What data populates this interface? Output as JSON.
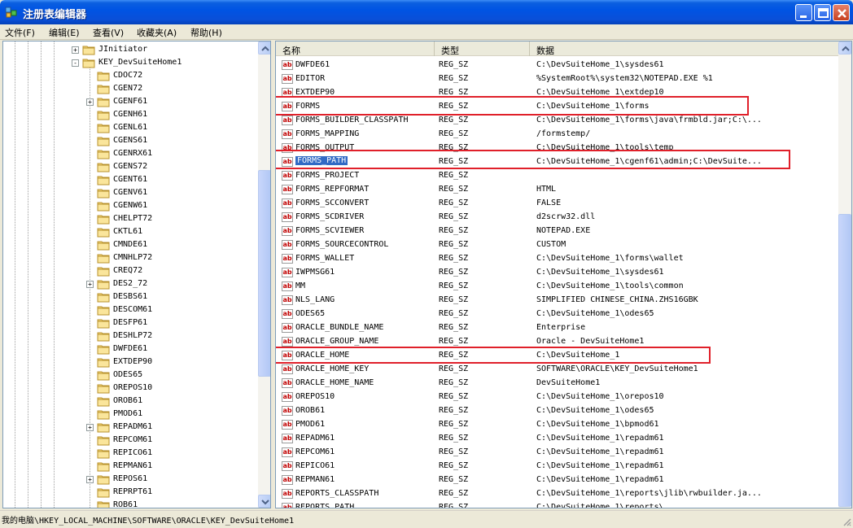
{
  "window": {
    "title": "注册表编辑器"
  },
  "menu": [
    {
      "label": "文件(F)"
    },
    {
      "label": "编辑(E)"
    },
    {
      "label": "查看(V)"
    },
    {
      "label": "收藏夹(A)"
    },
    {
      "label": "帮助(H)"
    }
  ],
  "tree": {
    "nodes": [
      {
        "label": "JInitiator",
        "expander": "+",
        "level": 0
      },
      {
        "label": "KEY_DevSuiteHome1",
        "expander": "-",
        "level": 0,
        "open": true
      },
      {
        "label": "CDOC72",
        "expander": "",
        "level": 1
      },
      {
        "label": "CGEN72",
        "expander": "",
        "level": 1
      },
      {
        "label": "CGENF61",
        "expander": "+",
        "level": 1
      },
      {
        "label": "CGENH61",
        "expander": "",
        "level": 1
      },
      {
        "label": "CGENL61",
        "expander": "",
        "level": 1
      },
      {
        "label": "CGENS61",
        "expander": "",
        "level": 1
      },
      {
        "label": "CGENRX61",
        "expander": "",
        "level": 1
      },
      {
        "label": "CGENS72",
        "expander": "",
        "level": 1
      },
      {
        "label": "CGENT61",
        "expander": "",
        "level": 1
      },
      {
        "label": "CGENV61",
        "expander": "",
        "level": 1
      },
      {
        "label": "CGENW61",
        "expander": "",
        "level": 1
      },
      {
        "label": "CHELPT72",
        "expander": "",
        "level": 1
      },
      {
        "label": "CKTL61",
        "expander": "",
        "level": 1
      },
      {
        "label": "CMNDE61",
        "expander": "",
        "level": 1
      },
      {
        "label": "CMNHLP72",
        "expander": "",
        "level": 1
      },
      {
        "label": "CREQ72",
        "expander": "",
        "level": 1
      },
      {
        "label": "DES2_72",
        "expander": "+",
        "level": 1
      },
      {
        "label": "DESBS61",
        "expander": "",
        "level": 1
      },
      {
        "label": "DESCOM61",
        "expander": "",
        "level": 1
      },
      {
        "label": "DESFP61",
        "expander": "",
        "level": 1
      },
      {
        "label": "DESHLP72",
        "expander": "",
        "level": 1
      },
      {
        "label": "DWFDE61",
        "expander": "",
        "level": 1
      },
      {
        "label": "EXTDEP90",
        "expander": "",
        "level": 1
      },
      {
        "label": "ODES65",
        "expander": "",
        "level": 1
      },
      {
        "label": "OREPOS10",
        "expander": "",
        "level": 1
      },
      {
        "label": "OROB61",
        "expander": "",
        "level": 1
      },
      {
        "label": "PMOD61",
        "expander": "",
        "level": 1
      },
      {
        "label": "REPADM61",
        "expander": "+",
        "level": 1
      },
      {
        "label": "REPCOM61",
        "expander": "",
        "level": 1
      },
      {
        "label": "REPICO61",
        "expander": "",
        "level": 1
      },
      {
        "label": "REPMAN61",
        "expander": "",
        "level": 1
      },
      {
        "label": "REPOS61",
        "expander": "+",
        "level": 1
      },
      {
        "label": "REPRPT61",
        "expander": "",
        "level": 1
      },
      {
        "label": "ROB61",
        "expander": "",
        "level": 1
      }
    ]
  },
  "list": {
    "columns": [
      "名称",
      "类型",
      "数据"
    ],
    "rows": [
      {
        "name": "DWFDE61",
        "type": "REG_SZ",
        "data": "C:\\DevSuiteHome_1\\sysdes61"
      },
      {
        "name": "EDITOR",
        "type": "REG_SZ",
        "data": "%SystemRoot%\\system32\\NOTEPAD.EXE %1"
      },
      {
        "name": "EXTDEP90",
        "type": "REG_SZ",
        "data": "C:\\DevSuiteHome_1\\extdep10"
      },
      {
        "name": "FORMS",
        "type": "REG_SZ",
        "data": "C:\\DevSuiteHome_1\\forms"
      },
      {
        "name": "FORMS_BUILDER_CLASSPATH",
        "type": "REG_SZ",
        "data": "C:\\DevSuiteHome_1\\forms\\java\\frmbld.jar;C:\\..."
      },
      {
        "name": "FORMS_MAPPING",
        "type": "REG_SZ",
        "data": "/formstemp/"
      },
      {
        "name": "FORMS_OUTPUT",
        "type": "REG_SZ",
        "data": "C:\\DevSuiteHome_1\\tools\\temp"
      },
      {
        "name": "FORMS_PATH",
        "type": "REG_SZ",
        "data": "C:\\DevSuiteHome_1\\cgenf61\\admin;C:\\DevSuite...",
        "selected": true
      },
      {
        "name": "FORMS_PROJECT",
        "type": "REG_SZ",
        "data": ""
      },
      {
        "name": "FORMS_REPFORMAT",
        "type": "REG_SZ",
        "data": "HTML"
      },
      {
        "name": "FORMS_SCCONVERT",
        "type": "REG_SZ",
        "data": "FALSE"
      },
      {
        "name": "FORMS_SCDRIVER",
        "type": "REG_SZ",
        "data": "d2scrw32.dll"
      },
      {
        "name": "FORMS_SCVIEWER",
        "type": "REG_SZ",
        "data": "NOTEPAD.EXE"
      },
      {
        "name": "FORMS_SOURCECONTROL",
        "type": "REG_SZ",
        "data": "CUSTOM"
      },
      {
        "name": "FORMS_WALLET",
        "type": "REG_SZ",
        "data": "C:\\DevSuiteHome_1\\forms\\wallet"
      },
      {
        "name": "IWPMSG61",
        "type": "REG_SZ",
        "data": "C:\\DevSuiteHome_1\\sysdes61"
      },
      {
        "name": "MM",
        "type": "REG_SZ",
        "data": "C:\\DevSuiteHome_1\\tools\\common"
      },
      {
        "name": "NLS_LANG",
        "type": "REG_SZ",
        "data": "SIMPLIFIED CHINESE_CHINA.ZHS16GBK"
      },
      {
        "name": "ODES65",
        "type": "REG_SZ",
        "data": "C:\\DevSuiteHome_1\\odes65"
      },
      {
        "name": "ORACLE_BUNDLE_NAME",
        "type": "REG_SZ",
        "data": "Enterprise"
      },
      {
        "name": "ORACLE_GROUP_NAME",
        "type": "REG_SZ",
        "data": "Oracle - DevSuiteHome1"
      },
      {
        "name": "ORACLE_HOME",
        "type": "REG_SZ",
        "data": "C:\\DevSuiteHome_1"
      },
      {
        "name": "ORACLE_HOME_KEY",
        "type": "REG_SZ",
        "data": "SOFTWARE\\ORACLE\\KEY_DevSuiteHome1"
      },
      {
        "name": "ORACLE_HOME_NAME",
        "type": "REG_SZ",
        "data": "DevSuiteHome1"
      },
      {
        "name": "OREPOS10",
        "type": "REG_SZ",
        "data": "C:\\DevSuiteHome_1\\orepos10"
      },
      {
        "name": "OROB61",
        "type": "REG_SZ",
        "data": "C:\\DevSuiteHome_1\\odes65"
      },
      {
        "name": "PMOD61",
        "type": "REG_SZ",
        "data": "C:\\DevSuiteHome_1\\bpmod61"
      },
      {
        "name": "REPADM61",
        "type": "REG_SZ",
        "data": "C:\\DevSuiteHome_1\\repadm61"
      },
      {
        "name": "REPCOM61",
        "type": "REG_SZ",
        "data": "C:\\DevSuiteHome_1\\repadm61"
      },
      {
        "name": "REPICO61",
        "type": "REG_SZ",
        "data": "C:\\DevSuiteHome_1\\repadm61"
      },
      {
        "name": "REPMAN61",
        "type": "REG_SZ",
        "data": "C:\\DevSuiteHome_1\\repadm61"
      },
      {
        "name": "REPORTS_CLASSPATH",
        "type": "REG_SZ",
        "data": "C:\\DevSuiteHome_1\\reports\\jlib\\rwbuilder.ja..."
      },
      {
        "name": "REPORTS_PATH",
        "type": "REG_SZ",
        "data": "C:\\DevSuiteHome_1\\reports\\..."
      }
    ]
  },
  "icons": {
    "value_icon_text": "ab"
  },
  "highlight_color": "#e0202a",
  "status": {
    "path": "我的电脑\\HKEY_LOCAL_MACHINE\\SOFTWARE\\ORACLE\\KEY_DevSuiteHome1"
  }
}
